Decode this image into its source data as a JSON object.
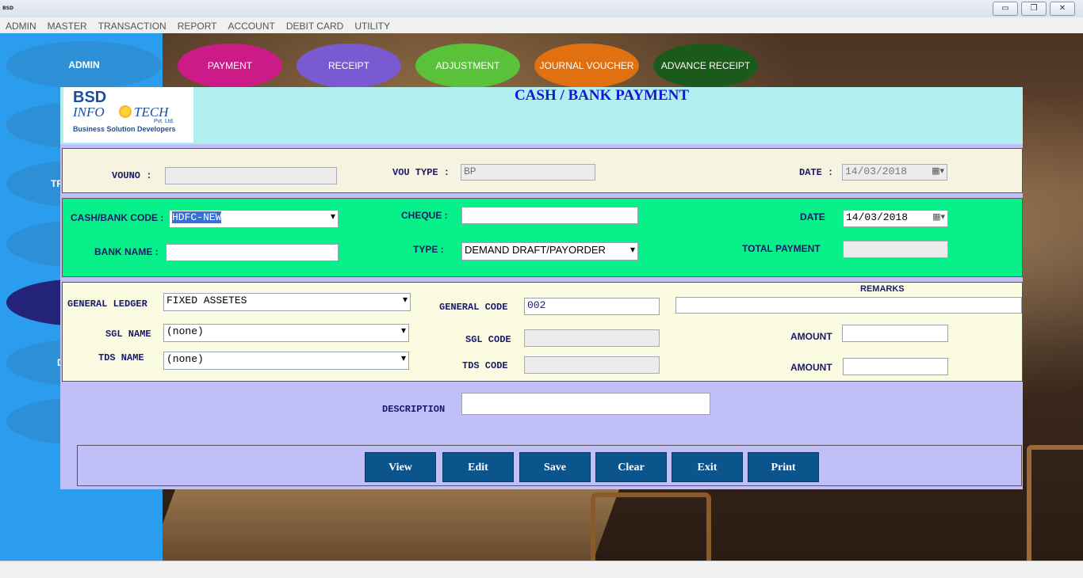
{
  "window": {
    "icon_text": "BSD",
    "controls": [
      "▭",
      "❐",
      "✕"
    ]
  },
  "menu": [
    "ADMIN",
    "MASTER",
    "TRANSACTION",
    "REPORT",
    "ACCOUNT",
    "DEBIT CARD",
    "UTILITY"
  ],
  "side": {
    "items": [
      "ADMIN",
      "",
      "TR",
      "",
      "",
      "D",
      ""
    ]
  },
  "tabs": [
    {
      "label": "PAYMENT",
      "color": "#cc1b86"
    },
    {
      "label": "RECEIPT",
      "color": "#7a5ad0"
    },
    {
      "label": "ADJUSTMENT",
      "color": "#5ac23a"
    },
    {
      "label": "JOURNAL VOUCHER",
      "color": "#e07010"
    },
    {
      "label": "ADVANCE RECEIPT",
      "color": "#1a5a1a"
    }
  ],
  "logo": {
    "line1": "BSD",
    "info": "INFO",
    "tech": "TECH",
    "pvt": "Pvt. Ltd.",
    "tagline": "Business Solution Developers"
  },
  "title": "CASH / BANK PAYMENT",
  "voucher": {
    "vouno_label": "VOUNO :",
    "vouno": "",
    "voutype_label": "VOU TYPE :",
    "voutype": "BP",
    "date_label": "DATE :",
    "date": "14/03/2018"
  },
  "bank": {
    "code_label": "CASH/BANK CODE :",
    "code": "HDFC-NEW",
    "cheque_label": "CHEQUE :",
    "cheque": "",
    "date_label": "DATE",
    "date": "14/03/2018",
    "name_label": "BANK NAME :",
    "name": "",
    "type_label": "TYPE :",
    "type": "DEMAND DRAFT/PAYORDER",
    "total_label": "TOTAL PAYMENT",
    "total": ""
  },
  "ledger": {
    "gl_label": "GENERAL LEDGER",
    "gl": "FIXED ASSETES",
    "gcode_label": "GENERAL CODE",
    "gcode": "002",
    "remarks_label": "REMARKS",
    "remarks": "",
    "sgl_label": "SGL NAME",
    "sgl": "(none)",
    "sglcode_label": "SGL CODE",
    "sglcode": "",
    "amount1_label": "AMOUNT",
    "amount1": "",
    "tds_label": "TDS NAME",
    "tds": "(none)",
    "tdscode_label": "TDS CODE",
    "tdscode": "",
    "amount2_label": "AMOUNT",
    "amount2": ""
  },
  "description_label": "DESCRIPTION",
  "description": "",
  "buttons": [
    "View",
    "Edit",
    "Save",
    "Clear",
    "Exit",
    "Print"
  ]
}
